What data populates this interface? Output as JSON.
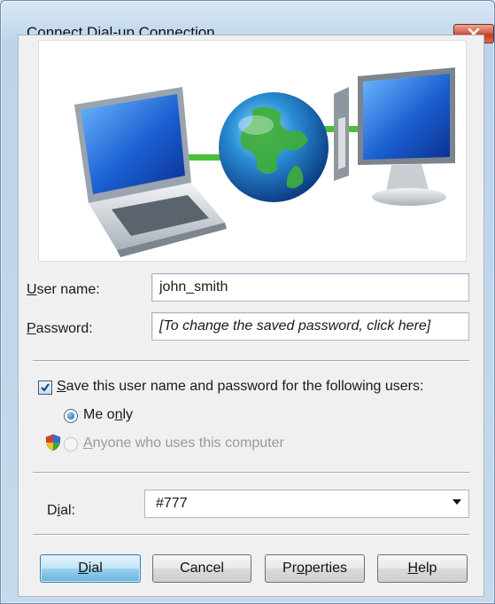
{
  "window": {
    "title": "Connect Dial-up Connection"
  },
  "form": {
    "username_label_key": "U",
    "username_label_rest": "ser name:",
    "username_value": "john_smith",
    "password_label_key": "P",
    "password_label_rest": "assword:",
    "password_value": "[To change the saved password, click here]"
  },
  "save": {
    "checked": true,
    "label_key": "S",
    "label_rest": "ave this user name and password for the following users:",
    "option_me_pre": "Me o",
    "option_me_key": "n",
    "option_me_post": "ly",
    "option_anyone_key": "A",
    "option_anyone_rest": "nyone who uses this computer"
  },
  "dial": {
    "label_pre": "D",
    "label_key": "i",
    "label_post": "al:",
    "value": "#777"
  },
  "buttons": {
    "dial_key": "D",
    "dial_rest": "ial",
    "cancel": "Cancel",
    "properties_pre": "Pr",
    "properties_key": "o",
    "properties_post": "perties",
    "help_key": "H",
    "help_rest": "elp"
  },
  "icons": [
    "close-icon",
    "laptop-icon",
    "globe-icon",
    "desktop-computer-icon",
    "uac-shield-icon",
    "checkmark-icon",
    "dropdown-arrow-icon"
  ]
}
